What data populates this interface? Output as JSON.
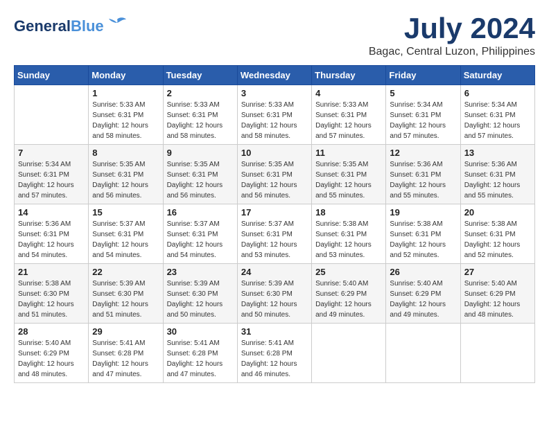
{
  "header": {
    "logo_line1": "General",
    "logo_line2": "Blue",
    "month": "July 2024",
    "location": "Bagac, Central Luzon, Philippines"
  },
  "weekdays": [
    "Sunday",
    "Monday",
    "Tuesday",
    "Wednesday",
    "Thursday",
    "Friday",
    "Saturday"
  ],
  "weeks": [
    [
      {
        "day": "",
        "info": ""
      },
      {
        "day": "1",
        "info": "Sunrise: 5:33 AM\nSunset: 6:31 PM\nDaylight: 12 hours\nand 58 minutes."
      },
      {
        "day": "2",
        "info": "Sunrise: 5:33 AM\nSunset: 6:31 PM\nDaylight: 12 hours\nand 58 minutes."
      },
      {
        "day": "3",
        "info": "Sunrise: 5:33 AM\nSunset: 6:31 PM\nDaylight: 12 hours\nand 58 minutes."
      },
      {
        "day": "4",
        "info": "Sunrise: 5:33 AM\nSunset: 6:31 PM\nDaylight: 12 hours\nand 57 minutes."
      },
      {
        "day": "5",
        "info": "Sunrise: 5:34 AM\nSunset: 6:31 PM\nDaylight: 12 hours\nand 57 minutes."
      },
      {
        "day": "6",
        "info": "Sunrise: 5:34 AM\nSunset: 6:31 PM\nDaylight: 12 hours\nand 57 minutes."
      }
    ],
    [
      {
        "day": "7",
        "info": "Sunrise: 5:34 AM\nSunset: 6:31 PM\nDaylight: 12 hours\nand 57 minutes."
      },
      {
        "day": "8",
        "info": "Sunrise: 5:35 AM\nSunset: 6:31 PM\nDaylight: 12 hours\nand 56 minutes."
      },
      {
        "day": "9",
        "info": "Sunrise: 5:35 AM\nSunset: 6:31 PM\nDaylight: 12 hours\nand 56 minutes."
      },
      {
        "day": "10",
        "info": "Sunrise: 5:35 AM\nSunset: 6:31 PM\nDaylight: 12 hours\nand 56 minutes."
      },
      {
        "day": "11",
        "info": "Sunrise: 5:35 AM\nSunset: 6:31 PM\nDaylight: 12 hours\nand 55 minutes."
      },
      {
        "day": "12",
        "info": "Sunrise: 5:36 AM\nSunset: 6:31 PM\nDaylight: 12 hours\nand 55 minutes."
      },
      {
        "day": "13",
        "info": "Sunrise: 5:36 AM\nSunset: 6:31 PM\nDaylight: 12 hours\nand 55 minutes."
      }
    ],
    [
      {
        "day": "14",
        "info": "Sunrise: 5:36 AM\nSunset: 6:31 PM\nDaylight: 12 hours\nand 54 minutes."
      },
      {
        "day": "15",
        "info": "Sunrise: 5:37 AM\nSunset: 6:31 PM\nDaylight: 12 hours\nand 54 minutes."
      },
      {
        "day": "16",
        "info": "Sunrise: 5:37 AM\nSunset: 6:31 PM\nDaylight: 12 hours\nand 54 minutes."
      },
      {
        "day": "17",
        "info": "Sunrise: 5:37 AM\nSunset: 6:31 PM\nDaylight: 12 hours\nand 53 minutes."
      },
      {
        "day": "18",
        "info": "Sunrise: 5:38 AM\nSunset: 6:31 PM\nDaylight: 12 hours\nand 53 minutes."
      },
      {
        "day": "19",
        "info": "Sunrise: 5:38 AM\nSunset: 6:31 PM\nDaylight: 12 hours\nand 52 minutes."
      },
      {
        "day": "20",
        "info": "Sunrise: 5:38 AM\nSunset: 6:31 PM\nDaylight: 12 hours\nand 52 minutes."
      }
    ],
    [
      {
        "day": "21",
        "info": "Sunrise: 5:38 AM\nSunset: 6:30 PM\nDaylight: 12 hours\nand 51 minutes."
      },
      {
        "day": "22",
        "info": "Sunrise: 5:39 AM\nSunset: 6:30 PM\nDaylight: 12 hours\nand 51 minutes."
      },
      {
        "day": "23",
        "info": "Sunrise: 5:39 AM\nSunset: 6:30 PM\nDaylight: 12 hours\nand 50 minutes."
      },
      {
        "day": "24",
        "info": "Sunrise: 5:39 AM\nSunset: 6:30 PM\nDaylight: 12 hours\nand 50 minutes."
      },
      {
        "day": "25",
        "info": "Sunrise: 5:40 AM\nSunset: 6:29 PM\nDaylight: 12 hours\nand 49 minutes."
      },
      {
        "day": "26",
        "info": "Sunrise: 5:40 AM\nSunset: 6:29 PM\nDaylight: 12 hours\nand 49 minutes."
      },
      {
        "day": "27",
        "info": "Sunrise: 5:40 AM\nSunset: 6:29 PM\nDaylight: 12 hours\nand 48 minutes."
      }
    ],
    [
      {
        "day": "28",
        "info": "Sunrise: 5:40 AM\nSunset: 6:29 PM\nDaylight: 12 hours\nand 48 minutes."
      },
      {
        "day": "29",
        "info": "Sunrise: 5:41 AM\nSunset: 6:28 PM\nDaylight: 12 hours\nand 47 minutes."
      },
      {
        "day": "30",
        "info": "Sunrise: 5:41 AM\nSunset: 6:28 PM\nDaylight: 12 hours\nand 47 minutes."
      },
      {
        "day": "31",
        "info": "Sunrise: 5:41 AM\nSunset: 6:28 PM\nDaylight: 12 hours\nand 46 minutes."
      },
      {
        "day": "",
        "info": ""
      },
      {
        "day": "",
        "info": ""
      },
      {
        "day": "",
        "info": ""
      }
    ]
  ]
}
